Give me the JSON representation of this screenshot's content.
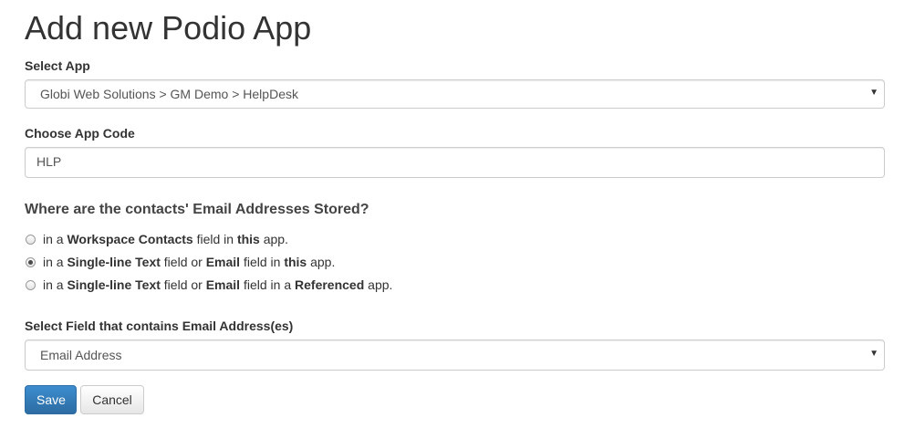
{
  "page": {
    "title": "Add new Podio App"
  },
  "select_app": {
    "label": "Select App",
    "value": "Globi Web Solutions > GM Demo > HelpDesk"
  },
  "app_code": {
    "label": "Choose App Code",
    "value": "HLP"
  },
  "email_location": {
    "question": "Where are the contacts' Email Addresses Stored?",
    "options": [
      {
        "selected": false,
        "parts": [
          "in a ",
          "Workspace Contacts",
          " field in ",
          "this",
          " app."
        ]
      },
      {
        "selected": true,
        "parts": [
          "in a ",
          "Single-line Text",
          " field or ",
          "Email",
          " field in ",
          "this",
          " app."
        ]
      },
      {
        "selected": false,
        "parts": [
          "in a ",
          "Single-line Text",
          " field or ",
          "Email",
          " field in a ",
          "Referenced",
          " app."
        ]
      }
    ]
  },
  "email_field": {
    "label": "Select Field that contains Email Address(es)",
    "value": "Email Address"
  },
  "buttons": {
    "save_label": "Save",
    "cancel_label": "Cancel"
  },
  "colors": {
    "primary": "#337ab7",
    "text": "#333333"
  }
}
